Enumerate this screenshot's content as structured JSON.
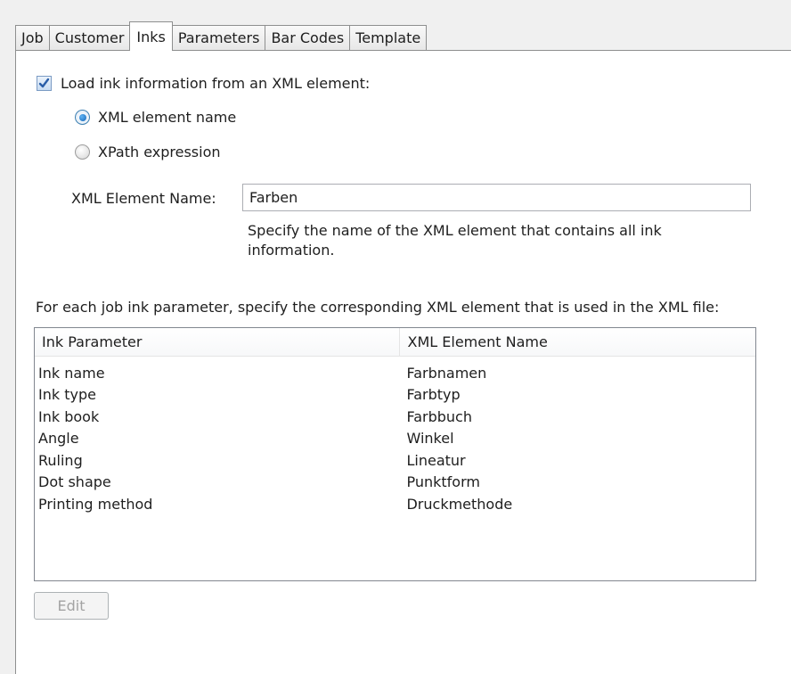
{
  "tabs": [
    {
      "label": "Job"
    },
    {
      "label": "Customer"
    },
    {
      "label": "Inks",
      "active": true
    },
    {
      "label": "Parameters"
    },
    {
      "label": "Bar Codes"
    },
    {
      "label": "Template"
    }
  ],
  "load_ink": {
    "checked": true,
    "label": "Load ink information from an XML element:"
  },
  "mode": {
    "selected": "XML element name",
    "option_element_name": "XML element name",
    "option_xpath": "XPath expression"
  },
  "element_name": {
    "label": "XML Element Name:",
    "value": "Farben",
    "hint": "Specify the name of the XML element that contains all ink information."
  },
  "instruction": "For each job ink parameter, specify the corresponding XML element that is used in the XML file:",
  "table": {
    "columns": [
      "Ink Parameter",
      "XML Element Name"
    ],
    "rows": [
      {
        "param": "Ink name",
        "element": "Farbnamen"
      },
      {
        "param": "Ink type",
        "element": "Farbtyp"
      },
      {
        "param": "Ink book",
        "element": "Farbbuch"
      },
      {
        "param": "Angle",
        "element": "Winkel"
      },
      {
        "param": "Ruling",
        "element": "Lineatur"
      },
      {
        "param": "Dot shape",
        "element": "Punktform"
      },
      {
        "param": "Printing method",
        "element": "Druckmethode"
      }
    ]
  },
  "edit_button": {
    "label": "Edit",
    "enabled": false
  },
  "colors": {
    "checkmark": "#2a5ea8",
    "radio_selected": "#1566b8",
    "disabled_text": "#a3a3a3"
  }
}
